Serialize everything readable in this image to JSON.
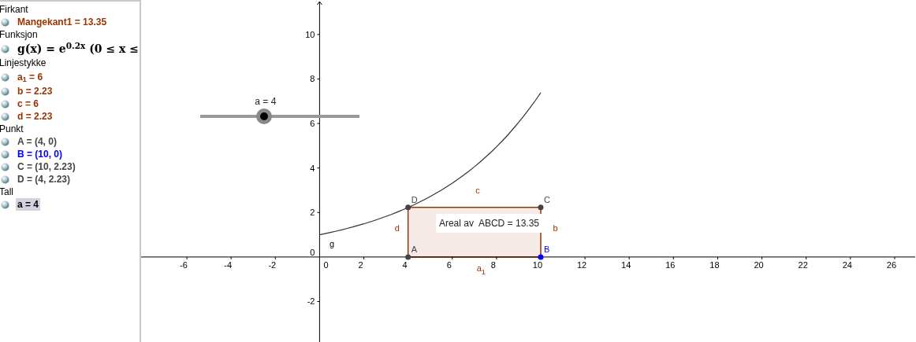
{
  "algebra": [
    {
      "heading": "Firkant",
      "items": [
        {
          "kind": "plain",
          "text": "Mangekant1 = 13.35",
          "color": "#993300",
          "selected": false
        }
      ]
    },
    {
      "heading": "Funksjon",
      "items": [
        {
          "kind": "math",
          "text": "g(x) = e$^{0.2x}$   (0 ≤ x ≤",
          "color": "#000000",
          "selected": false
        }
      ]
    },
    {
      "heading": "Linjestykke",
      "items": [
        {
          "kind": "plain",
          "text": "a$_{1}$ = 6",
          "color": "#993300",
          "selected": false
        },
        {
          "kind": "plain",
          "text": "b = 2.23",
          "color": "#993300",
          "selected": false
        },
        {
          "kind": "plain",
          "text": "c = 6",
          "color": "#993300",
          "selected": false
        },
        {
          "kind": "plain",
          "text": "d = 2.23",
          "color": "#993300",
          "selected": false
        }
      ]
    },
    {
      "heading": "Punkt",
      "items": [
        {
          "kind": "plain",
          "text": "A = (4, 0)",
          "color": "#444444",
          "selected": false
        },
        {
          "kind": "plain",
          "text": "B = (10, 0)",
          "color": "#0000ff",
          "selected": false
        },
        {
          "kind": "plain",
          "text": "C = (10, 2.23)",
          "color": "#444444",
          "selected": false
        },
        {
          "kind": "plain",
          "text": "D = (4, 2.23)",
          "color": "#444444",
          "selected": false
        }
      ]
    },
    {
      "heading": "Tall",
      "items": [
        {
          "kind": "plain",
          "text": "a = 4",
          "color": "#000000",
          "selected": true
        }
      ]
    }
  ],
  "graphics": {
    "slider": {
      "label": "a = 4",
      "level": 0.4
    },
    "x_tick_labels": [
      "-6",
      "-4",
      "-2",
      "0",
      "2",
      "4",
      "6",
      "8",
      "10",
      "12",
      "14",
      "16",
      "18",
      "20",
      "22",
      "24",
      "26"
    ],
    "y_tick_labels": [
      "10",
      "8",
      "6",
      "4",
      "2",
      "0",
      "-2"
    ],
    "curve_label": "g",
    "segment_labels": [
      "c",
      "b",
      "d",
      "a$_{1}$"
    ],
    "text_box": "Areal av  ABCD = 13.35",
    "points": [
      {
        "label": "D",
        "color": "#444444"
      },
      {
        "label": "C",
        "color": "#444444"
      },
      {
        "label": "A",
        "color": "#444444"
      },
      {
        "label": "B",
        "color": "#0000ff"
      }
    ]
  }
}
